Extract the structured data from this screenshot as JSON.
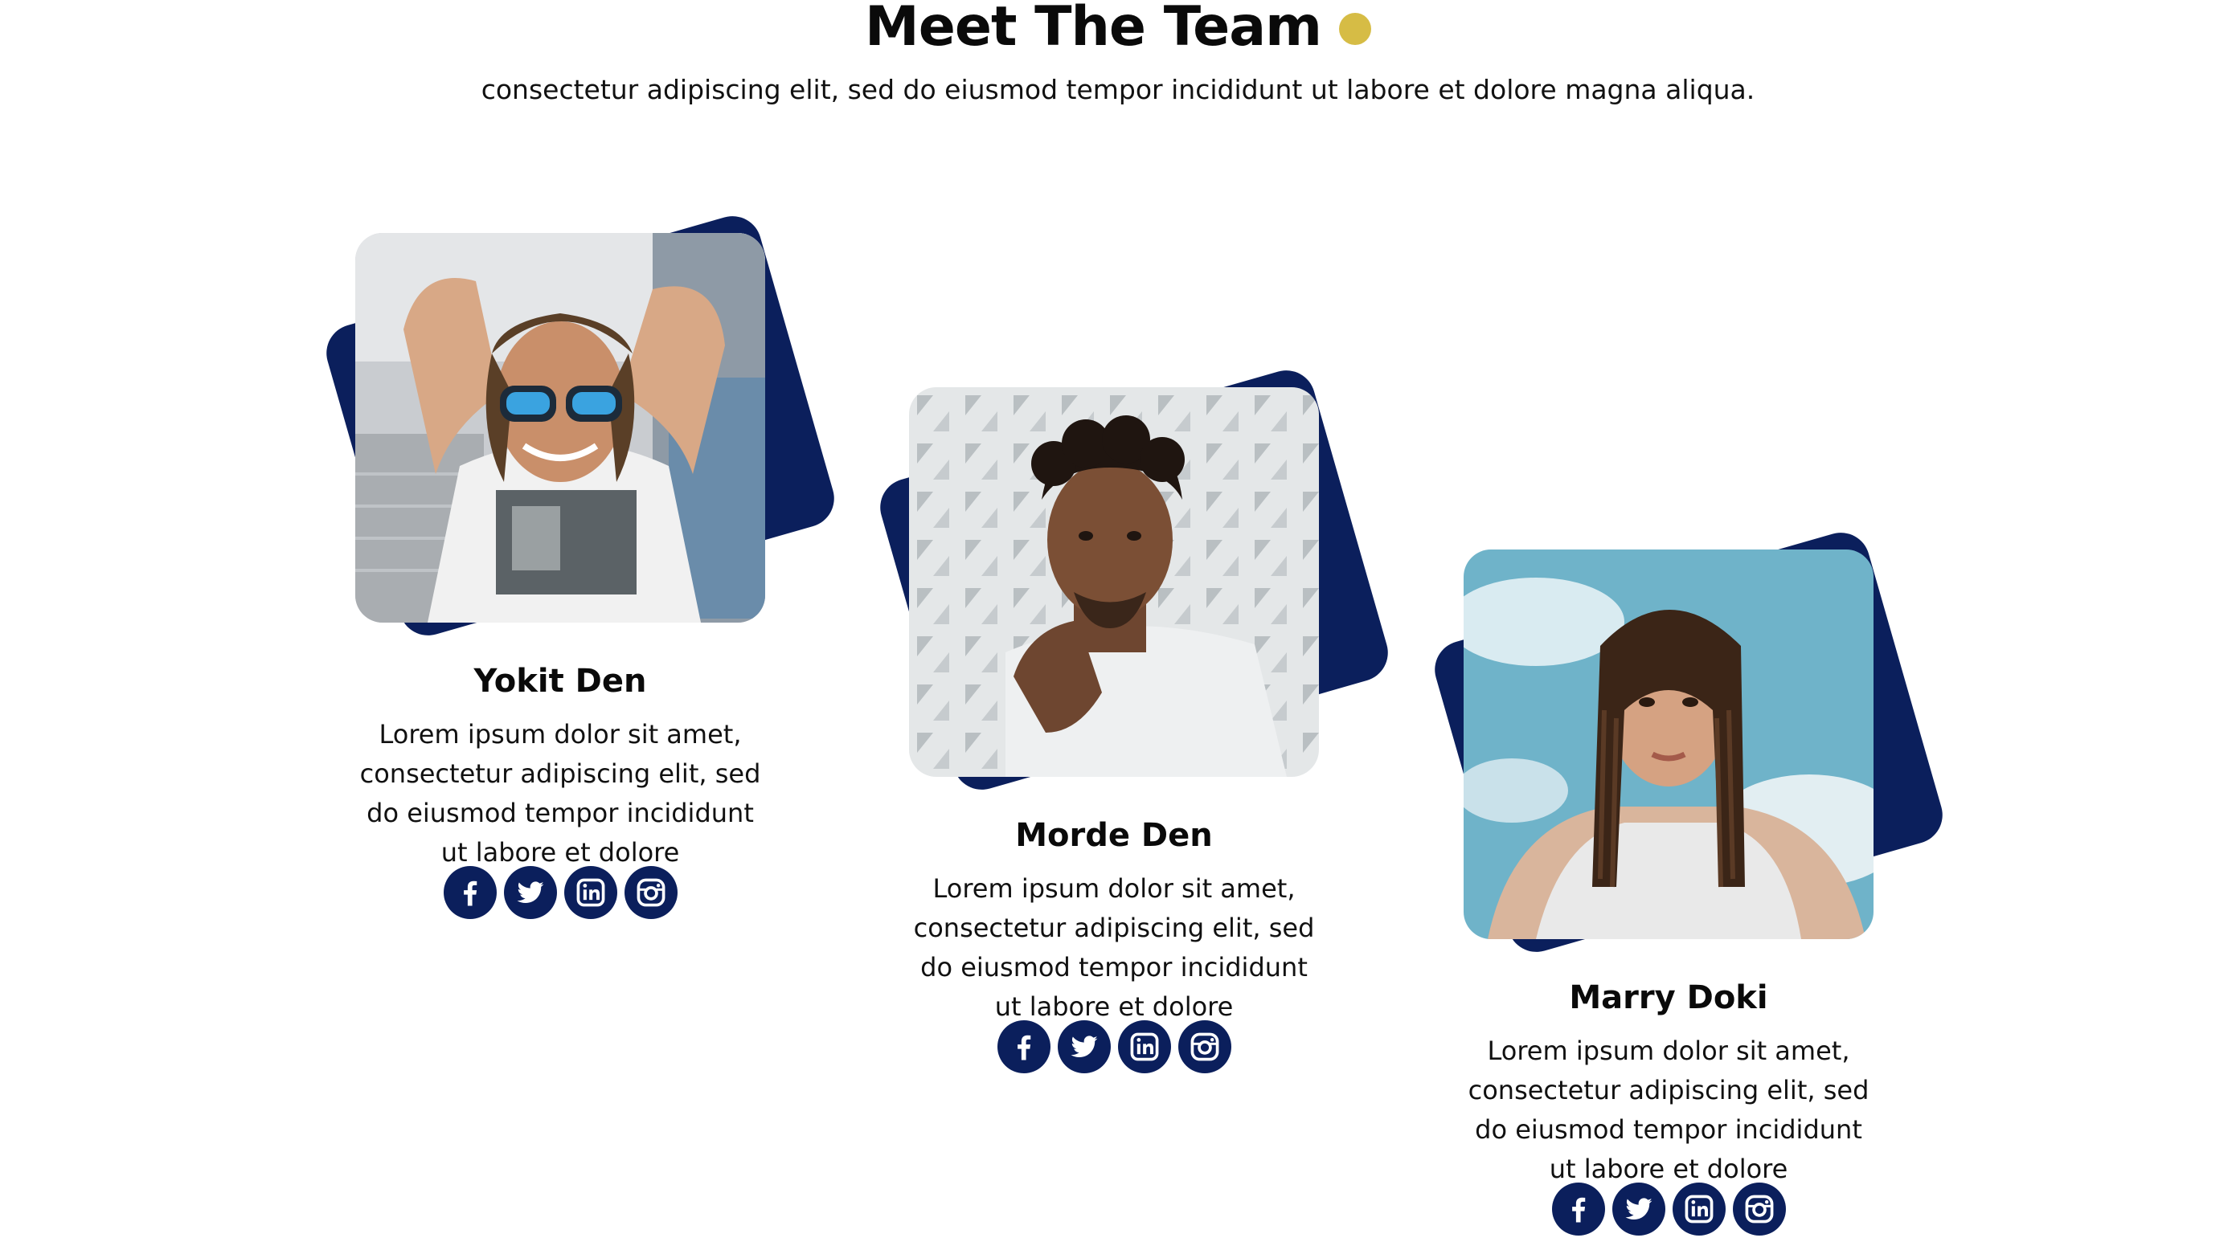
{
  "section": {
    "title": "Meet The Team",
    "subtitle": "consectetur adipiscing elit, sed do eiusmod tempor incididunt ut labore et dolore magna aliqua."
  },
  "colors": {
    "accent_dot": "#d6bc45",
    "navy": "#0b1f5c",
    "text": "#111111"
  },
  "members": [
    {
      "name": "Yokit Den",
      "bio": "Lorem ipsum dolor sit amet, consectetur adipiscing elit, sed do eiusmod tempor incididunt ut labore et dolore",
      "photo": "man-with-sunglasses-photo",
      "socials": [
        "facebook-icon",
        "twitter-icon",
        "linkedin-icon",
        "instagram-icon"
      ]
    },
    {
      "name": "Morde Den",
      "bio": "Lorem ipsum dolor sit amet, consectetur adipiscing elit, sed do eiusmod tempor incididunt ut labore et dolore",
      "photo": "man-curly-hair-photo",
      "socials": [
        "facebook-icon",
        "twitter-icon",
        "linkedin-icon",
        "instagram-icon"
      ]
    },
    {
      "name": "Marry Doki",
      "bio": "Lorem ipsum dolor sit amet, consectetur adipiscing elit, sed do eiusmod tempor incididunt ut labore et dolore",
      "photo": "woman-braids-photo",
      "socials": [
        "facebook-icon",
        "twitter-icon",
        "linkedin-icon",
        "instagram-icon"
      ]
    }
  ]
}
